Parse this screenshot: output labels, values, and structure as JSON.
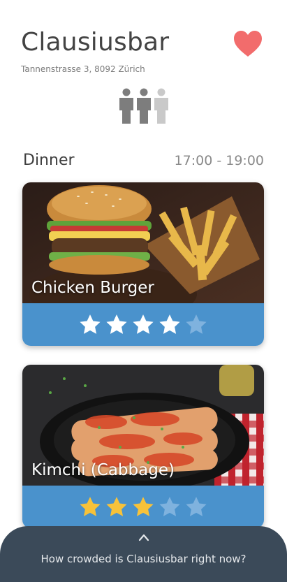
{
  "restaurant": {
    "name": "Clausiusbar",
    "address": "Tannenstrasse 3, 8092 Zürich",
    "favorite": true,
    "crowd_level": {
      "active": 2,
      "total": 3
    }
  },
  "meal": {
    "label": "Dinner",
    "time": "17:00 - 19:00"
  },
  "dishes": [
    {
      "name": "Chicken Burger",
      "rating": 4,
      "max_rating": 5
    },
    {
      "name": "Kimchi (Cabbage)",
      "rating": 3,
      "max_rating": 5
    }
  ],
  "bottom_sheet": {
    "prompt": "How crowded is Clausiusbar right now?"
  },
  "colors": {
    "heart": "#f26c6c",
    "rating_bar": "#4a92cc",
    "star_filled_dish1": "#ffffff",
    "star_filled_dish2": "#f7c23a",
    "star_empty": "#7fb2de",
    "crowd_active": "#7d7d7d",
    "crowd_inactive": "#c9c9c9",
    "sheet": "#3b4a59"
  }
}
